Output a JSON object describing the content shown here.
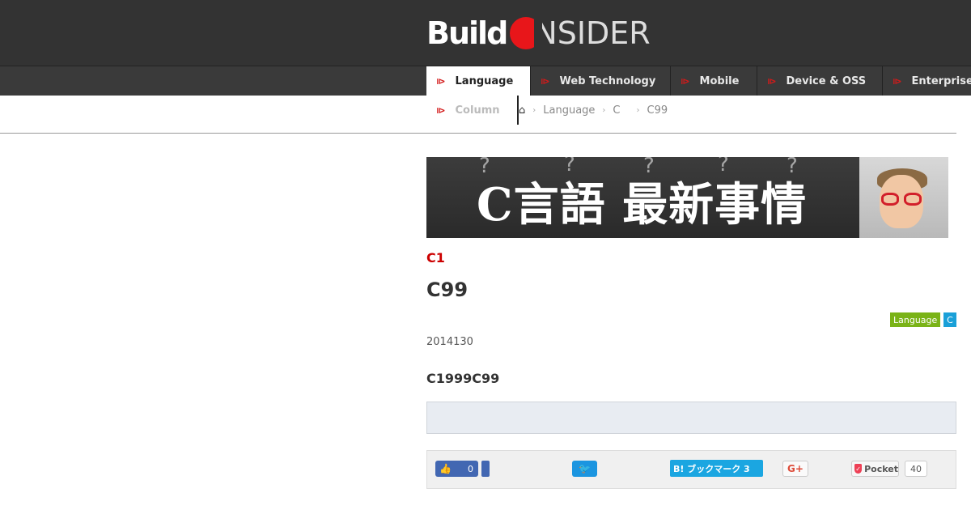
{
  "header": {
    "logo_build": "Build",
    "logo_insider": "NSIDER"
  },
  "nav": {
    "items": [
      {
        "label": "Language",
        "active": true
      },
      {
        "label": "Web Technology"
      },
      {
        "label": "Mobile"
      },
      {
        "label": "Device & OSS"
      },
      {
        "label": "Enterprise"
      }
    ],
    "sub_item": "Column"
  },
  "breadcrumb": {
    "items": [
      "Language",
      "C",
      "C99"
    ]
  },
  "banner": {
    "text": "C言語 最新事情"
  },
  "article": {
    "series": "C1",
    "title": "C99",
    "tags": [
      "Language",
      "C"
    ],
    "date": "2014130",
    "lead": "C1999C99"
  },
  "share": {
    "fb_count": "0",
    "hatena_label": "B! ブックマーク 3",
    "gplus_label": "G+",
    "pocket_label": "Pocket",
    "pocket_count": "40"
  },
  "colors": {
    "header_bg": "#333333",
    "accent_red": "#e8161a",
    "tag_language": "#7ab317",
    "tag_c": "#1aa0d8"
  }
}
